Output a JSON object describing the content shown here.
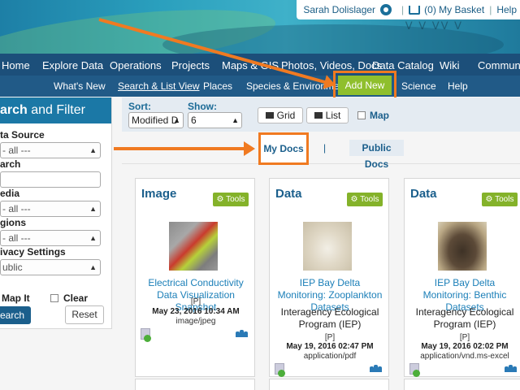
{
  "user": {
    "name": "Sarah Dolislager",
    "basket": "(0) My Basket",
    "help": "Help"
  },
  "main_nav": [
    "Home",
    "Explore Data",
    "Operations",
    "Projects",
    "Maps & GIS",
    "Photos, Videos, Docs",
    "Data Catalog",
    "Wiki",
    "Community"
  ],
  "sub_nav": [
    "What's New",
    "Search & List View",
    "Places",
    "Species & Environment",
    "Add New",
    "Science",
    "Help"
  ],
  "sidebar": {
    "title_bold": "arch",
    "title_rest": " and Filter",
    "data_source_label": "ta Source",
    "data_source_value": "- all ---",
    "search_label": "arch",
    "media_label": "edia",
    "media_value": "- all ---",
    "regions_label": "gions",
    "regions_value": "- all ---",
    "privacy_label": "ivacy Settings",
    "privacy_value": "ublic",
    "map_it": "Map It",
    "clear": "Clear",
    "search_button": "earch",
    "reset_button": "Reset"
  },
  "toolbar": {
    "sort_label": "Sort:",
    "sort_value": "Modified D",
    "show_label": "Show:",
    "show_value": "6",
    "grid": "Grid",
    "list": "List",
    "map": "Map"
  },
  "doc_tabs": {
    "my_docs": "My Docs",
    "separator": "|",
    "public_docs": "Public Docs"
  },
  "cards": [
    {
      "type": "Image",
      "tools": "Tools",
      "title": "Electrical Conductivity Data Visualization Snapshot",
      "org": "",
      "privacy": "[P]",
      "date": "May 23, 2016 10:34 AM",
      "mime": "image/jpeg"
    },
    {
      "type": "Data",
      "tools": "Tools",
      "title": "IEP Bay Delta Monitoring: Zooplankton Datasets",
      "org": "Interagency Ecological Program (IEP)",
      "privacy": "[P]",
      "date": "May 19, 2016 02:47 PM",
      "mime": "application/pdf"
    },
    {
      "type": "Data",
      "tools": "Tools",
      "title": "IEP Bay Delta Monitoring: Benthic Datasets",
      "org": "Interagency Ecological Program (IEP)",
      "privacy": "[P]",
      "date": "May 19, 2016 02:02 PM",
      "mime": "application/vnd.ms-excel"
    }
  ],
  "colors": {
    "accent_orange": "#f07a21",
    "nav_dark": "#1c4f7a",
    "add_new_green": "#8fbf2d",
    "link_blue": "#1b7fb8"
  }
}
